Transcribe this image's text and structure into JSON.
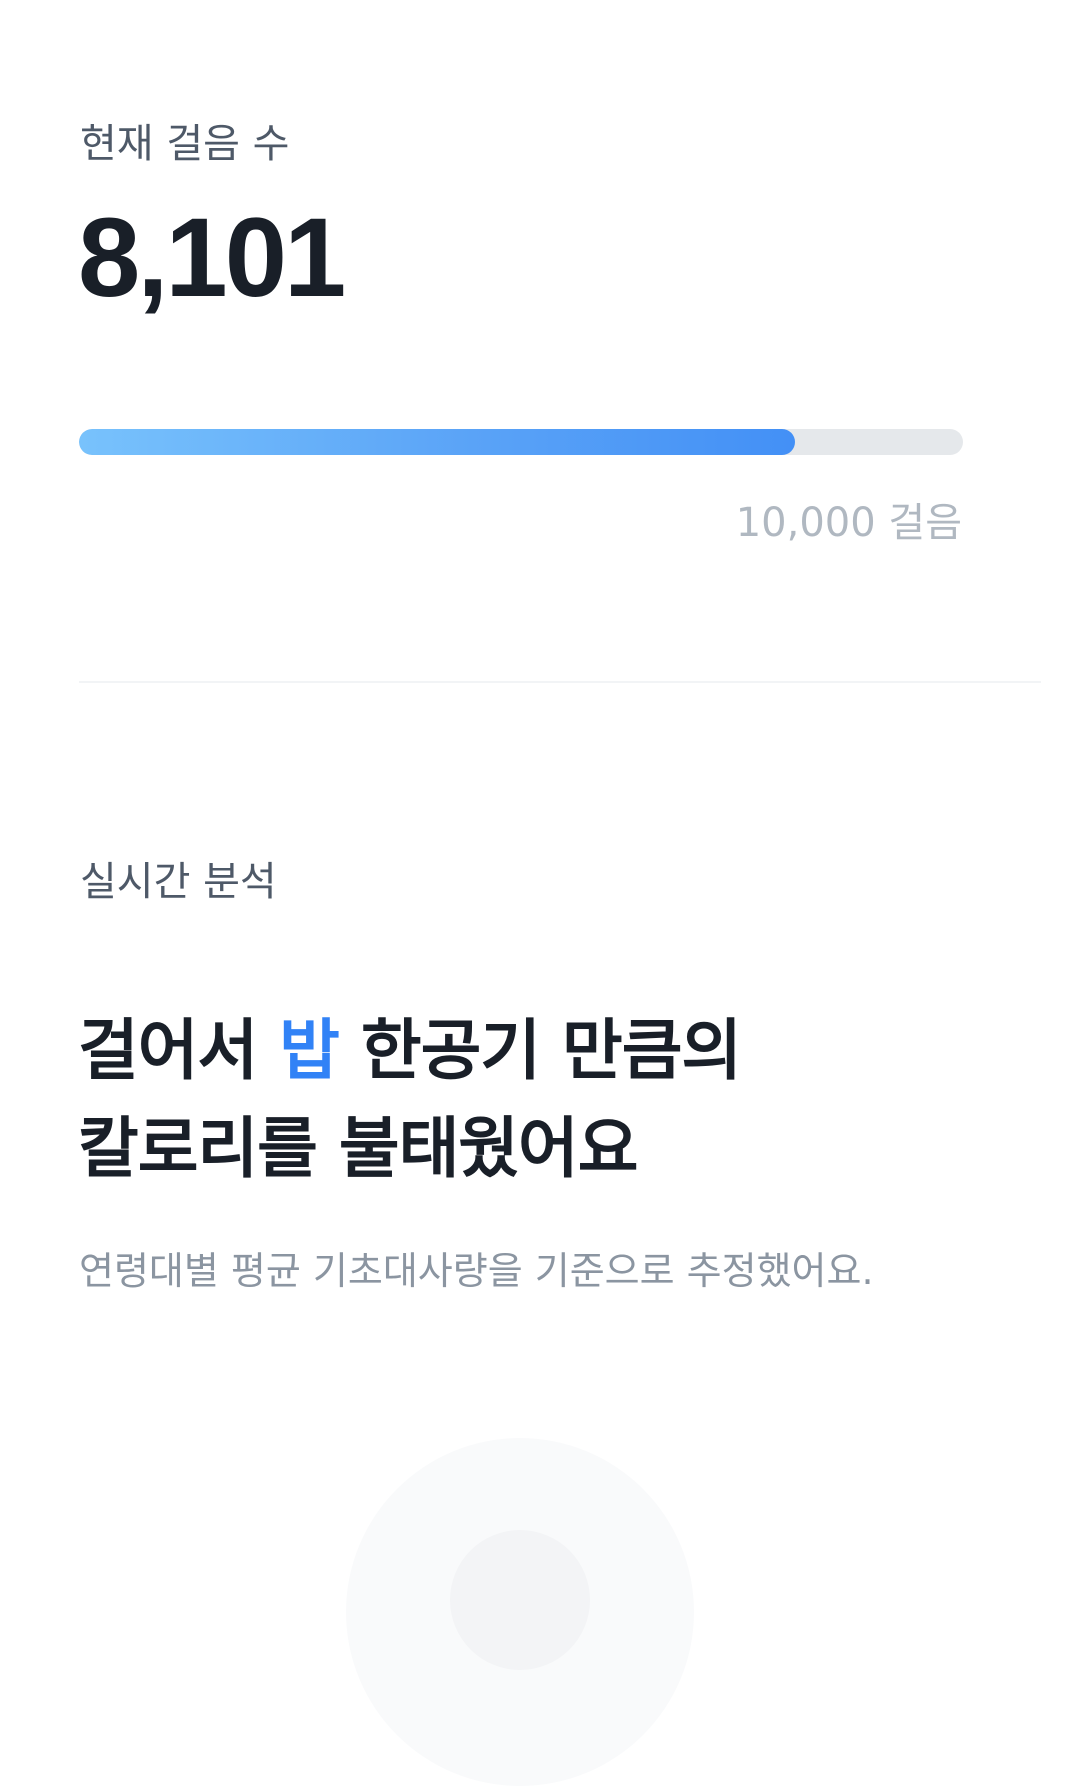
{
  "steps": {
    "label": "현재 걸음 수",
    "value": "8,101",
    "current": 8101,
    "goal": 10000,
    "goal_label": "10,000 걸음",
    "bar_color_start": "#78c2fc",
    "bar_color_end": "#4390f6",
    "track_color": "#e5e8eb"
  },
  "analysis": {
    "label": "실시간 분석",
    "headline_line1_pre": "걸어서 ",
    "headline_accent": "밥",
    "headline_line1_post": " 한공기 만큼의",
    "headline_line2": "칼로리를 불태웠어요",
    "accent_color": "#3182f6",
    "description": "연령대별 평균 기초대사량을 기준으로 추정했어요."
  }
}
